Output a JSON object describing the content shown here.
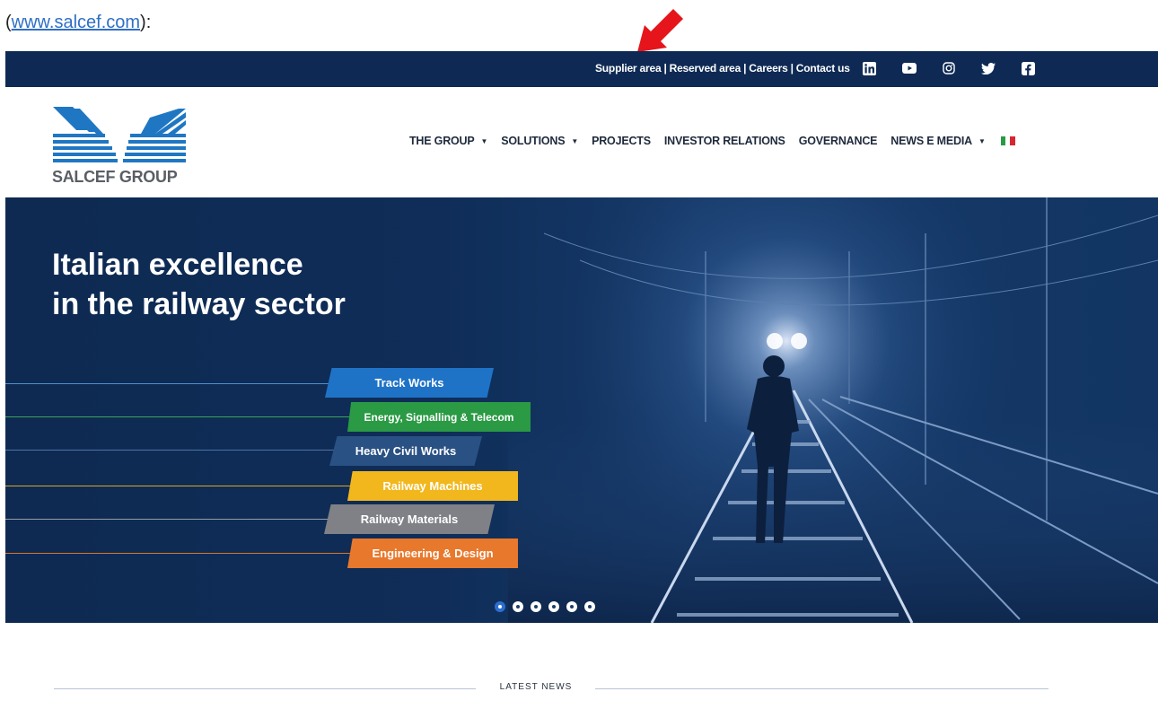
{
  "caption": {
    "prefix": "(",
    "link_text": "www.salcef.com",
    "suffix": "):"
  },
  "topbar": {
    "links": [
      "Supplier area",
      "Reserved area",
      "Careers",
      "Contact us"
    ],
    "separator": "|",
    "social_icons": [
      "linkedin-icon",
      "youtube-icon",
      "instagram-icon",
      "twitter-icon",
      "facebook-icon"
    ]
  },
  "header": {
    "logo_text": "SALCEF GROUP",
    "nav": [
      {
        "label": "THE GROUP",
        "dropdown": true
      },
      {
        "label": "SOLUTIONS",
        "dropdown": true
      },
      {
        "label": "PROJECTS",
        "dropdown": false
      },
      {
        "label": "INVESTOR RELATIONS",
        "dropdown": false
      },
      {
        "label": "GOVERNANCE",
        "dropdown": false
      },
      {
        "label": "NEWS E MEDIA",
        "dropdown": true
      }
    ],
    "language_flag": "italy-flag-icon"
  },
  "hero": {
    "title_line1": "Italian excellence",
    "title_line2": "in the railway sector",
    "tags": [
      {
        "label": "Track Works",
        "color": "#1f73c6"
      },
      {
        "label": "Energy, Signalling & Telecom",
        "color": "#2a9a44"
      },
      {
        "label": "Heavy Civil Works",
        "color": "#2a5184"
      },
      {
        "label": "Railway Machines",
        "color": "#f2b71c"
      },
      {
        "label": "Railway Materials",
        "color": "#7f8186"
      },
      {
        "label": "Engineering & Design",
        "color": "#e8782c"
      }
    ],
    "slide_count": 6,
    "active_slide": 1
  },
  "news": {
    "section_label": "LATEST NEWS"
  },
  "colors": {
    "topbar_bg": "#0e2a54",
    "hero_bg": "#0f2d58",
    "pointer_arrow": "#e5151b"
  }
}
